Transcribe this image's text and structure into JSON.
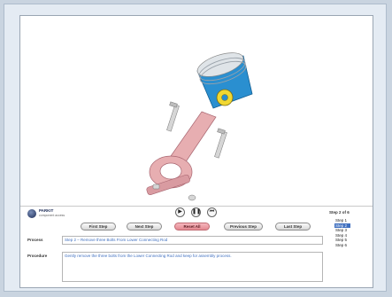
{
  "viewer": {
    "colors": {
      "piston": "#2a8fd0",
      "piston_dark": "#176aa8",
      "rod": "#e7aeb1",
      "rod_dark": "#c98890",
      "pin": "#f1d832",
      "bolt": "#d6d6d6"
    }
  },
  "logo": {
    "name": "PARKIT",
    "sub": "component access"
  },
  "media": {
    "play_icon": "▶",
    "pause_icon": "❚❚",
    "stop_icon": "⏮"
  },
  "nav": {
    "first": "First Step",
    "next": "Next Step",
    "reset": "Reset All",
    "previous": "Previous Step",
    "last": "Last Step"
  },
  "steps": {
    "counter": "Step 2 of 6",
    "items": [
      "Step 1",
      "Step 2",
      "Step 3",
      "Step 4",
      "Step 5",
      "Step 6"
    ],
    "active_index": 1
  },
  "process": {
    "label": "Process",
    "value": "Step 2 – Remove three Bolts From Lower Connecting Rod"
  },
  "procedure": {
    "label": "Procedure",
    "value": "Gently remove the three bolts from the Lower Connecting Rod and keep for assembly process."
  }
}
